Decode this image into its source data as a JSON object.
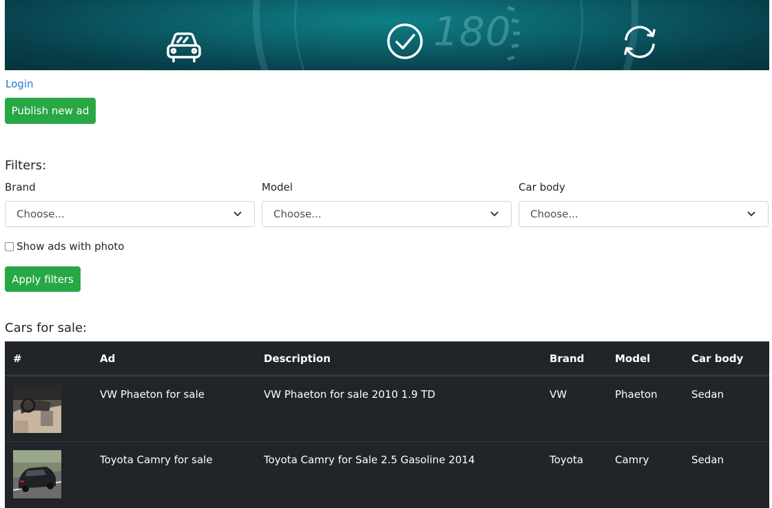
{
  "banner": {
    "speed_text": "180",
    "icons": [
      "car-icon",
      "check-circle-icon",
      "refresh-icon"
    ]
  },
  "nav": {
    "login_label": "Login"
  },
  "actions": {
    "publish_label": "Publish new ad"
  },
  "filters": {
    "heading": "Filters:",
    "brand": {
      "label": "Brand",
      "value": "Choose..."
    },
    "model": {
      "label": "Model",
      "value": "Choose..."
    },
    "car_body": {
      "label": "Car body",
      "value": "Choose..."
    },
    "photo_checkbox": {
      "label": "Show ads with photo",
      "checked": false
    },
    "apply_label": "Apply filters"
  },
  "listings": {
    "heading": "Cars for sale:",
    "columns": [
      "#",
      "Ad",
      "Description",
      "Brand",
      "Model",
      "Car body"
    ],
    "rows": [
      {
        "ad": "VW Phaeton for sale",
        "description": "VW Phaeton for sale 2010 1.9 TD",
        "brand": "VW",
        "model": "Phaeton",
        "car_body": "Sedan"
      },
      {
        "ad": "Toyota Camry for sale",
        "description": "Toyota Camry for Sale 2.5 Gasoline 2014",
        "brand": "Toyota",
        "model": "Camry",
        "car_body": "Sedan"
      }
    ]
  },
  "colors": {
    "primary_green": "#28a745",
    "link_blue": "#1b78d0",
    "table_dark": "#212529",
    "banner_teal": "#0b5e68"
  }
}
